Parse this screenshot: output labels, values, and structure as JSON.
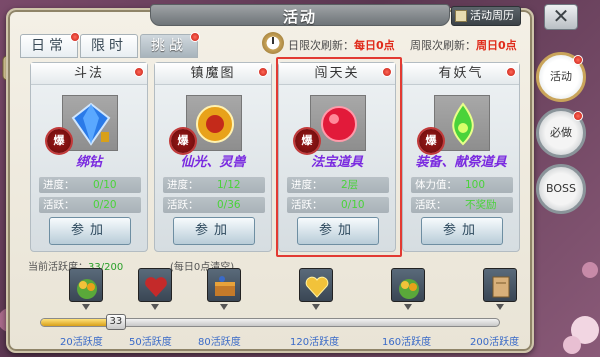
{
  "window": {
    "title": "活动",
    "calendar_button": "活动周历",
    "close_label": "✕"
  },
  "tabs": [
    {
      "label": "日常",
      "active": false,
      "badge": true
    },
    {
      "label": "限时",
      "active": false,
      "badge": false
    },
    {
      "label": "挑战",
      "active": true,
      "badge": true
    }
  ],
  "refresh": {
    "daily_label": "日限次刷新：",
    "daily_value": "每日0点",
    "weekly_label": "周限次刷新：",
    "weekly_value": "周日0点"
  },
  "cards": [
    {
      "title": "斗法",
      "reward": "绑钻",
      "burst": "爆",
      "row1_label": "进度：",
      "row1_value": "0/10",
      "row2_label": "活跃：",
      "row2_value": "0/20",
      "button": "参加",
      "icon": "diamond-icon",
      "selected": false
    },
    {
      "title": "镇魔图",
      "reward": "仙光、灵兽",
      "burst": "爆",
      "row1_label": "进度：",
      "row1_value": "1/12",
      "row2_label": "活跃：",
      "row2_value": "0/36",
      "button": "参加",
      "icon": "amulet-icon",
      "selected": false
    },
    {
      "title": "闯天关",
      "reward": "法宝道具",
      "burst": "爆",
      "row1_label": "进度：",
      "row1_value": "2层",
      "row2_label": "活跃：",
      "row2_value": "0/10",
      "button": "参加",
      "icon": "red-gem-icon",
      "selected": true
    },
    {
      "title": "有妖气",
      "reward": "装备、献祭道具",
      "burst": "爆",
      "row1_label": "体力值：",
      "row1_value": "100",
      "row2_label": "活跃：",
      "row2_value": "不奖励",
      "button": "参加",
      "icon": "green-gem-icon",
      "selected": false
    }
  ],
  "activity": {
    "label": "当前活跃度：",
    "current": "33",
    "total": "/200",
    "reset_note": "(每日0点清空)",
    "progress_value": 33,
    "progress_max": 200
  },
  "milestones": [
    "20活跃度",
    "50活跃度",
    "80活跃度",
    "120活跃度",
    "160活跃度",
    "200活跃度"
  ],
  "milestone_values": [
    20,
    50,
    80,
    120,
    160,
    200
  ],
  "milestone_icons": [
    "treasure-bag-icon",
    "heart-icon",
    "chest-icon",
    "gold-heart-icon",
    "treasure-bag-icon",
    "scroll-icon"
  ],
  "side_tabs": [
    {
      "label": "活动",
      "active": true,
      "badge": true
    },
    {
      "label": "必做",
      "active": false,
      "badge": true
    },
    {
      "label": "BOSS",
      "active": false,
      "badge": false
    }
  ],
  "colors": {
    "accent_red": "#e02a1a",
    "value_green": "#4ad33a",
    "reward_purple": "#7a2ae0",
    "milestone_blue": "#3a6ac8"
  }
}
